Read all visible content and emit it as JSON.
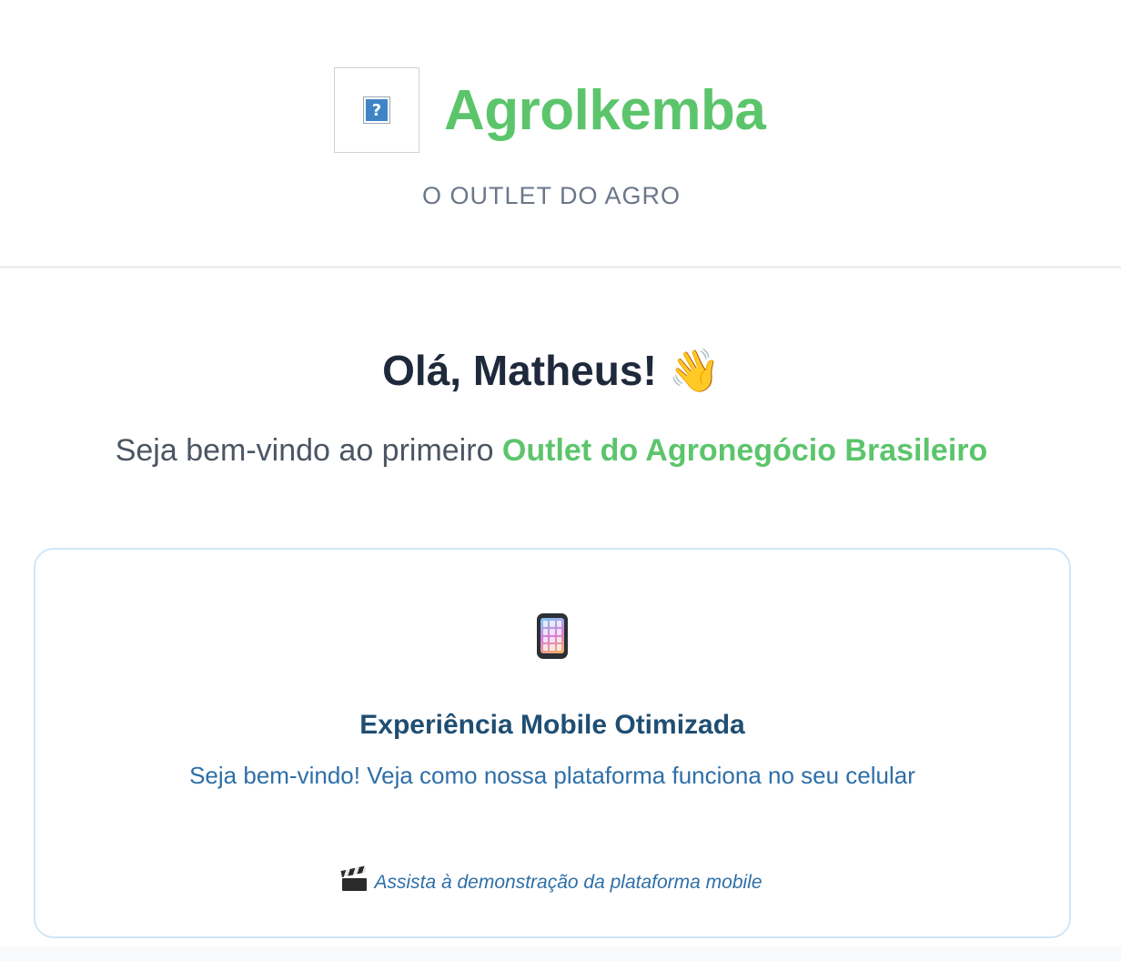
{
  "header": {
    "logo_icon": "broken-image-icon",
    "logo_glyph": "?",
    "brand_name": "Agrolkemba",
    "tagline": "O OUTLET DO AGRO"
  },
  "hero": {
    "greeting": "Olá, Matheus! 👋",
    "welcome_prefix": "Seja bem-vindo ao primeiro ",
    "welcome_highlight": "Outlet do Agronegócio Brasileiro"
  },
  "card": {
    "icon": "mobile-phone-icon",
    "title": "Experiência Mobile Otimizada",
    "subtitle": "Seja bem-vindo! Veja como nossa plataforma funciona no seu celular",
    "link_icon": "clapper-board-icon",
    "link_text": "Assista à demonstração da plataforma mobile"
  },
  "colors": {
    "brand_green": "#5cc56c",
    "heading_dark": "#1e293b",
    "card_title_blue": "#1f4e73",
    "card_text_blue": "#2e6fa8",
    "card_border": "#cfe6f4",
    "tagline_gray": "#6b7689"
  }
}
